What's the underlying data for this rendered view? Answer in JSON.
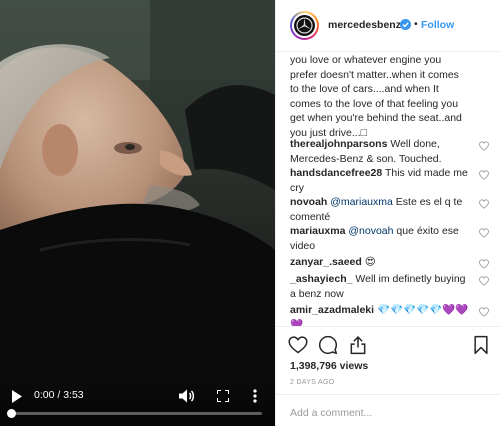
{
  "video": {
    "time_display": "0:00 / 3:53",
    "progress": 0
  },
  "post": {
    "username": "mercedesbenz",
    "dot": "•",
    "follow_label": "Follow",
    "caption": "you love or whatever engine you prefer doesn't matter..when it comes to the love of cars....and when It comes to the love of that feeling you get when you're behind the seat..and you just drive...",
    "caption_suffix": "□"
  },
  "comments": [
    {
      "user": "therealjohnparsons",
      "mention": "",
      "text": "Well done, Mercedes-Benz & son. Touched."
    },
    {
      "user": "handsdancefree28",
      "mention": "",
      "text": "This vid made me cry"
    },
    {
      "user": "novoah",
      "mention": "@mariauxma",
      "text": "Este es el q te comenté"
    },
    {
      "user": "mariauxma",
      "mention": "@novoah",
      "text": "que éxito ese video"
    },
    {
      "user": "zanyar_.saeed",
      "mention": "",
      "text": "😍"
    },
    {
      "user": "_ashayiech_",
      "mention": "",
      "text": "Well im definetly buying a benz now"
    },
    {
      "user": "amir_azadmaleki",
      "mention": "",
      "text": "💎💎💎💎💎💜💜💜"
    }
  ],
  "stats": {
    "views": "1,398,796 views",
    "posted": "2 DAYS AGO"
  },
  "add_comment": {
    "placeholder": "Add a comment..."
  },
  "icons": [
    "play-icon",
    "volume-icon",
    "fullscreen-icon",
    "more-vertical-icon",
    "verified-badge-icon",
    "heart-icon",
    "comment-icon",
    "share-icon",
    "bookmark-icon"
  ]
}
